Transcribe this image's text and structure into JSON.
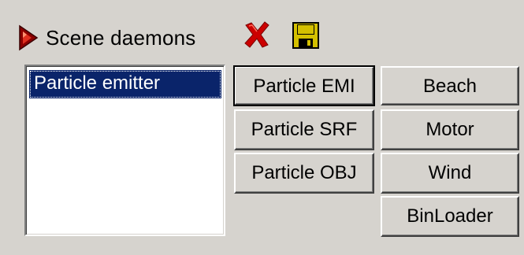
{
  "header": {
    "title": "Scene daemons",
    "icons": {
      "expand": "arrow-right-icon",
      "delete": "red-x-icon",
      "save": "floppy-disk-icon"
    }
  },
  "list": {
    "items": [
      {
        "label": "Particle emitter",
        "selected": true
      }
    ]
  },
  "buttons": {
    "particle_emi": "Particle EMI",
    "particle_srf": "Particle SRF",
    "particle_obj": "Particle OBJ",
    "beach": "Beach",
    "motor": "Motor",
    "wind": "Wind",
    "binloader": "BinLoader"
  },
  "colors": {
    "background": "#d6d3ce",
    "selection": "#0a246a",
    "delete_red": "#cc0000",
    "save_yellow": "#d4c000"
  }
}
